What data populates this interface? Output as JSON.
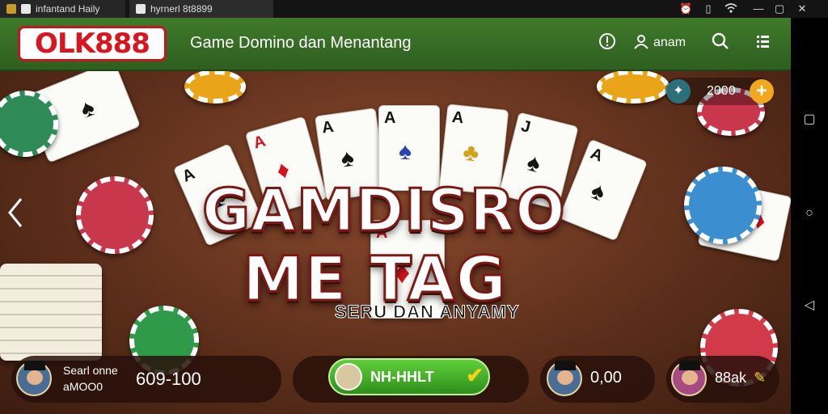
{
  "system_bar": {
    "tab1_label": "infantand Haily",
    "tab2_label": "hyrnerl 8t8899",
    "icons": [
      "app-icon",
      "game-tab-icon",
      "alarm-icon",
      "battery-icon",
      "wifi-icon",
      "minimize-icon",
      "restore-icon",
      "close-icon"
    ]
  },
  "header": {
    "logo_text": "OLK888",
    "title": "Game Domino dan Menantang",
    "user_label": "anam",
    "icons": [
      "info-icon",
      "user-icon",
      "search-icon",
      "menu-icon"
    ]
  },
  "coins": {
    "value": "2000",
    "plus": "+"
  },
  "banner": {
    "title_line1": "GAMDISRO",
    "title_line2": "ME  TAG",
    "subtitle": "SERU DAN ANYAMY"
  },
  "bottom_bar": {
    "player1_name": "Searl onne",
    "player1_sub": "aMOO0",
    "player1_score": "609-100",
    "play_button_label": "NH-HHLT",
    "player2_score": "0,00",
    "player3_score": "88ak"
  },
  "nav": {
    "left_arrow": "<"
  },
  "android_nav": [
    "square-icon",
    "circle-icon",
    "back-triangle-icon"
  ],
  "colors": {
    "header_green": "#3f7a2a",
    "logo_red": "#d9161f",
    "play_green": "#4cbf2c",
    "coin_orange": "#f2a81d"
  }
}
